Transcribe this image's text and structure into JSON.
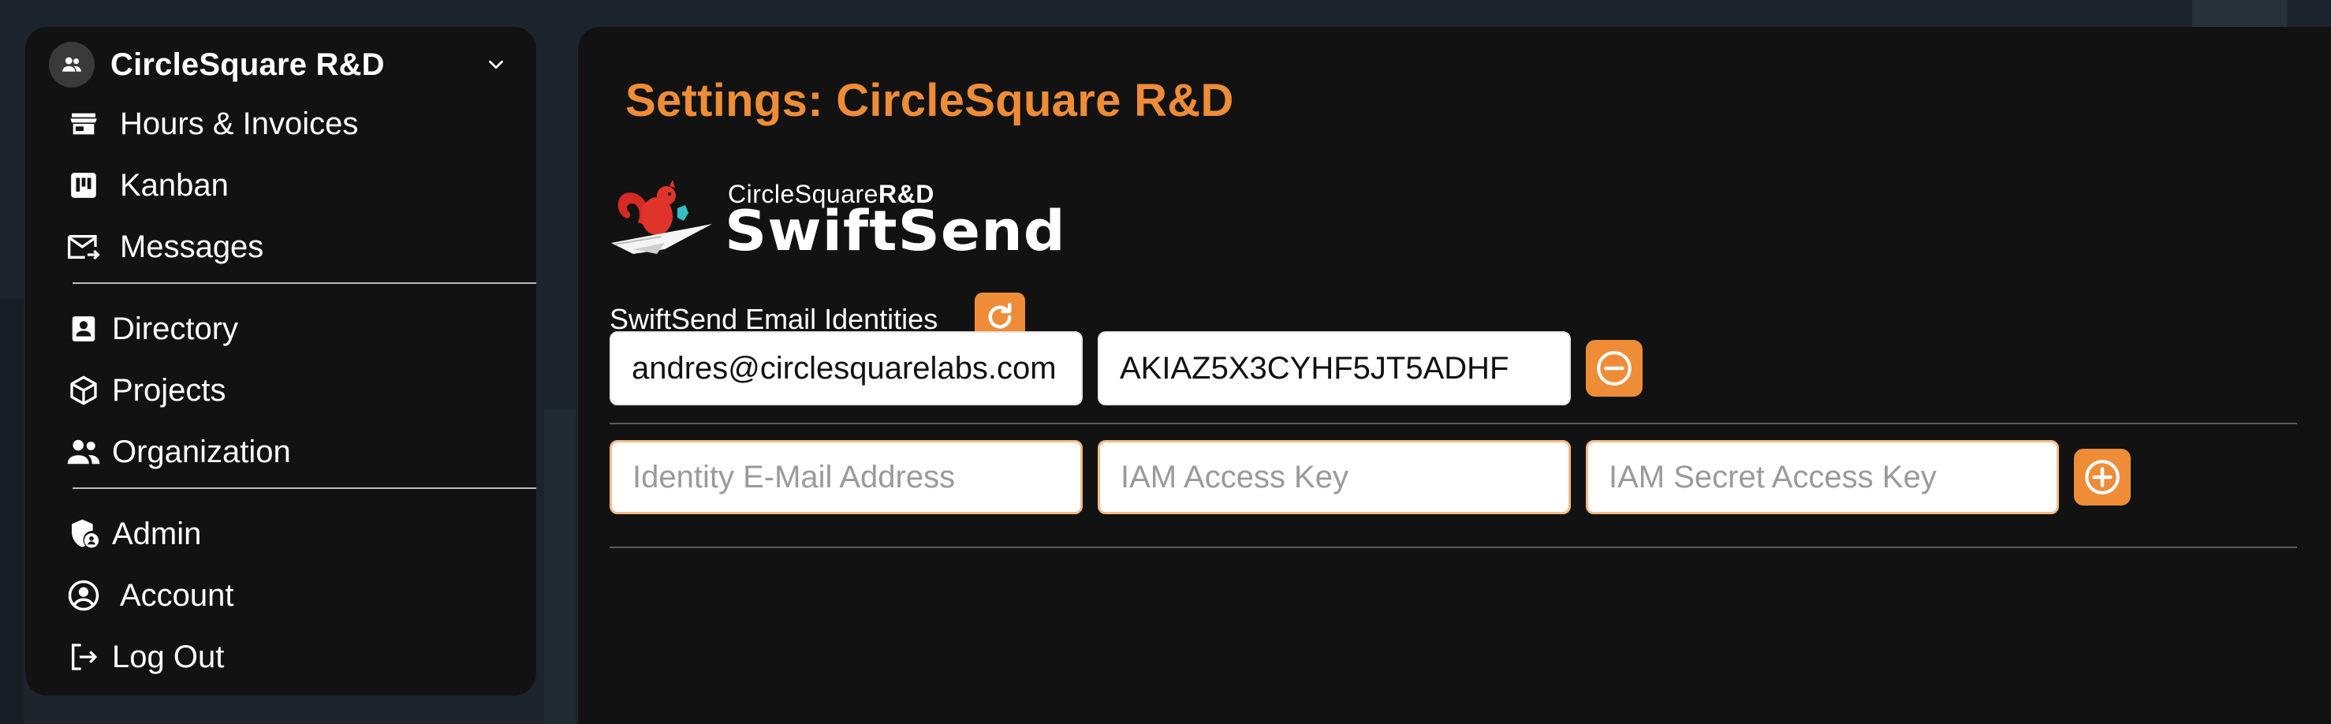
{
  "org": {
    "name": "CircleSquare R&D"
  },
  "nav": {
    "group1": [
      {
        "label": "Hours & Invoices",
        "icon": "store-icon"
      },
      {
        "label": "Kanban",
        "icon": "kanban-icon"
      },
      {
        "label": "Messages",
        "icon": "mail-icon"
      }
    ],
    "group2": [
      {
        "label": "Directory",
        "icon": "contact-card-icon"
      },
      {
        "label": "Projects",
        "icon": "cube-icon"
      },
      {
        "label": "Organization",
        "icon": "users-icon"
      }
    ],
    "group3": [
      {
        "label": "Admin",
        "icon": "shield-user-icon"
      },
      {
        "label": "Account",
        "icon": "account-circle-icon"
      },
      {
        "label": "Log Out",
        "icon": "logout-icon"
      }
    ]
  },
  "page": {
    "title": "Settings: CircleSquare R&D",
    "logo_small_regular": "CircleSquare",
    "logo_small_bold": "R&D",
    "logo_big": "SwiftSend",
    "section_label": "SwiftSend Email Identities"
  },
  "identities": [
    {
      "email": "andres@circlesquarelabs.com",
      "access_key": "AKIAZ5X3CYHF5JT5ADHF"
    }
  ],
  "new_identity": {
    "email_placeholder": "Identity E-Mail Address",
    "access_key_placeholder": "IAM Access Key",
    "secret_key_placeholder": "IAM Secret Access Key"
  },
  "colors": {
    "accent": "#ee8c37",
    "panel": "#121212",
    "input_border": "#f3bb86"
  }
}
